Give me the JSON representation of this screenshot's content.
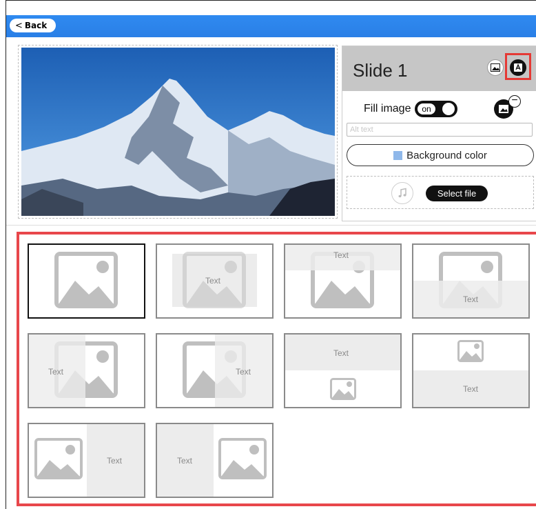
{
  "header": {
    "back_label": "Back",
    "back_chevron": "<"
  },
  "slide": {
    "title": "Slide 1",
    "fill_image_label": "Fill image",
    "toggle_label": "on",
    "alt_text_placeholder": "Alt text",
    "background_color_label": "Background color",
    "background_color_swatch": "#8fb8ea",
    "select_file_label": "Select file",
    "remove_symbol": "−"
  },
  "layouts": {
    "tiles": [
      {
        "id": "image-only",
        "text": ""
      },
      {
        "id": "text-over-image",
        "text": "Text"
      },
      {
        "id": "text-top-image",
        "text": "Text"
      },
      {
        "id": "text-bottom-image",
        "text": "Text"
      },
      {
        "id": "text-left-overlay",
        "text": "Text"
      },
      {
        "id": "text-right-overlay",
        "text": "Text"
      },
      {
        "id": "text-top-small-image",
        "text": "Text"
      },
      {
        "id": "small-image-top-text",
        "text": "Text"
      },
      {
        "id": "image-left-text-right",
        "text": "Text"
      },
      {
        "id": "text-left-image-right",
        "text": "Text"
      }
    ]
  },
  "colors": {
    "accent_bar": "#2a7fe6",
    "highlight": "#e53935"
  }
}
